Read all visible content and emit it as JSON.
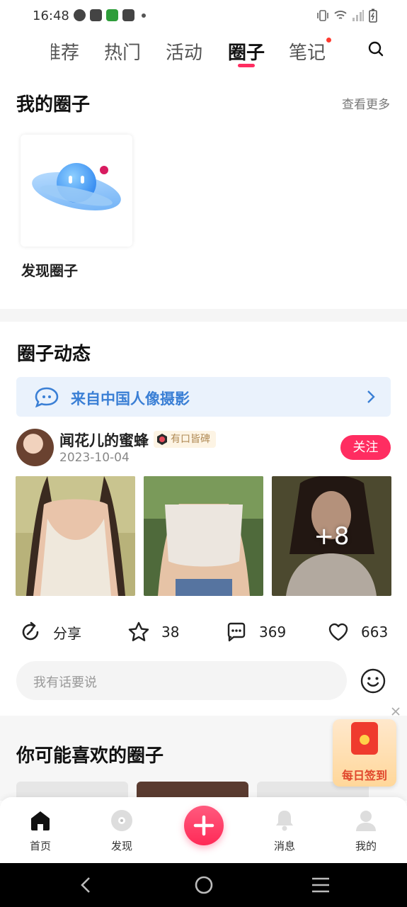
{
  "status_bar": {
    "time": "16:48"
  },
  "tabs": [
    "推荐",
    "热门",
    "活动",
    "圈子",
    "笔记"
  ],
  "active_tab": "圈子",
  "my_circles": {
    "title": "我的圈子",
    "see_more": "查看更多",
    "card_label": "发现圈子"
  },
  "circle_feed": {
    "title": "圈子动态",
    "banner_text": "来自中国人像摄影"
  },
  "post": {
    "username": "闻花儿的蜜蜂",
    "badge": "有口皆碑",
    "date": "2023-10-04",
    "follow_label": "关注",
    "more_photos": "+8",
    "share_label": "分享",
    "favorites": "38",
    "comments": "369",
    "likes": "663",
    "comment_placeholder": "我有话要说"
  },
  "suggestions": {
    "title": "你可能喜欢的圈子"
  },
  "checkin": {
    "label": "每日签到"
  },
  "bottom_nav": {
    "home": "首页",
    "discover": "发现",
    "messages": "消息",
    "mine": "我的"
  },
  "colors": {
    "accent": "#ff2d61",
    "link_blue": "#3a7fd5"
  }
}
